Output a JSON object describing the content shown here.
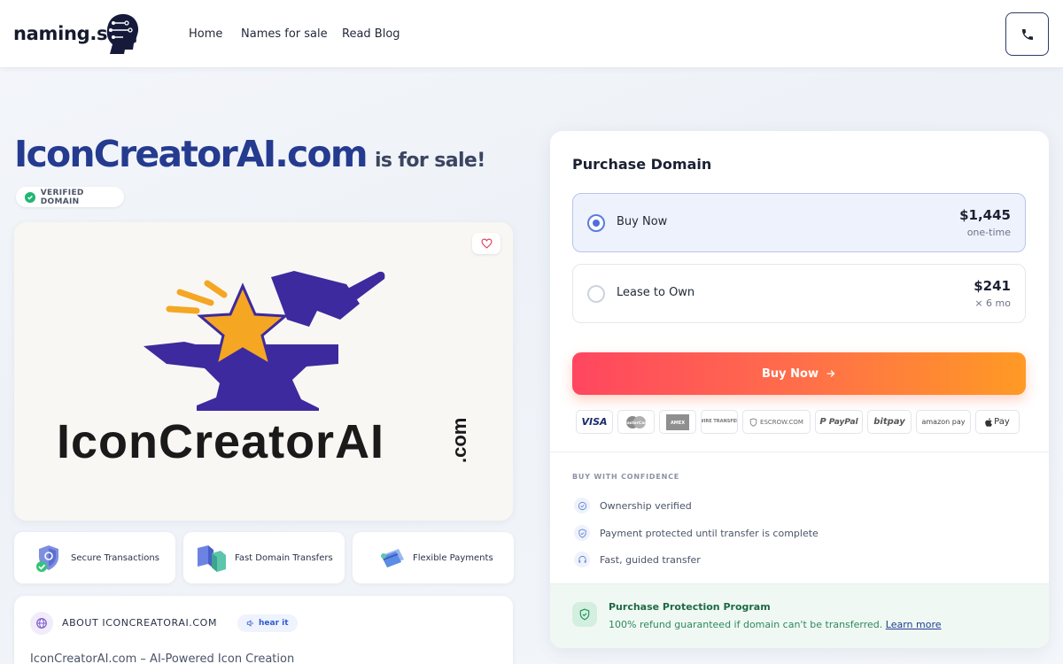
{
  "header": {
    "brand": "naming.si",
    "nav": [
      "Home",
      "Names for sale",
      "Read Blog"
    ]
  },
  "hero": {
    "domain": "IconCreatorAI.com",
    "suffix": "is for sale!",
    "badge": "VERIFIED DOMAIN"
  },
  "logo_card": {
    "wordmark": "IconCreatorAI",
    "tld": ".com"
  },
  "features": [
    "Secure Transactions",
    "Fast Domain Transfers",
    "Flexible Payments"
  ],
  "about": {
    "title": "ABOUT ICONCREATORAI.COM",
    "hear_it": "hear it",
    "subtitle": "IconCreatorAI.com – AI-Powered Icon Creation"
  },
  "purchase": {
    "title": "Purchase Domain",
    "options": [
      {
        "label": "Buy Now",
        "price": "$1,445",
        "sub": "one-time",
        "selected": true
      },
      {
        "label": "Lease to Own",
        "price": "$241",
        "sub": "× 6 mo",
        "selected": false
      }
    ],
    "cta": "Buy Now",
    "payment_methods": [
      "VISA",
      "MasterCard",
      "AMEX",
      "WIRE TRANSFER",
      "ESCROW.COM",
      "PayPal",
      "bitpay",
      "amazon pay",
      "Pay"
    ],
    "confidence_title": "BUY WITH CONFIDENCE",
    "confidence": [
      "Ownership verified",
      "Payment protected until transfer is complete",
      "Fast, guided transfer"
    ],
    "protection_title": "Purchase Protection Program",
    "protection_text": "100% refund guaranteed if domain can't be transferred.",
    "protection_link": "Learn more"
  },
  "colors": {
    "brand_navy": "#243b8f",
    "logo_purple": "#3d2a9e",
    "logo_gold": "#f5a623",
    "cta_start": "#ff4660",
    "cta_end": "#ff9a24",
    "success": "#22b573"
  }
}
